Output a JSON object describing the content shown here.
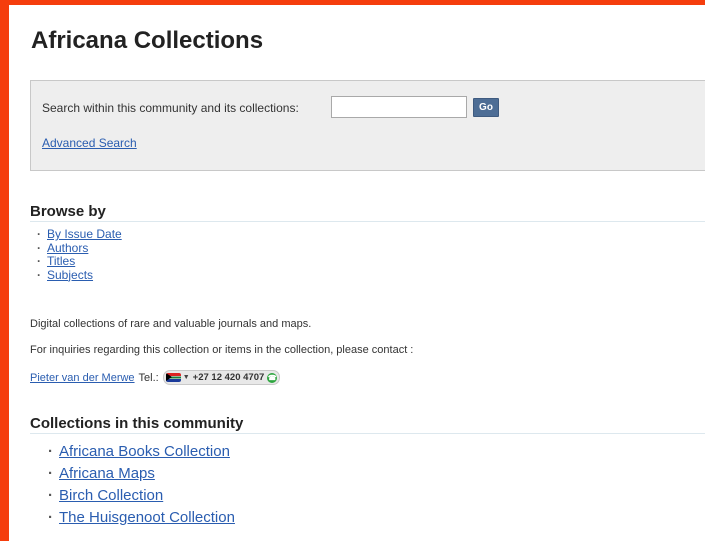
{
  "page": {
    "title": "Africana Collections"
  },
  "search": {
    "label": "Search within this community and its collections:",
    "input_value": "",
    "go_label": "Go",
    "advanced_label": "Advanced Search"
  },
  "browse": {
    "header": "Browse by",
    "items": [
      {
        "label": "By Issue Date"
      },
      {
        "label": "Authors"
      },
      {
        "label": "Titles"
      },
      {
        "label": "Subjects"
      }
    ]
  },
  "description": {
    "line1": "Digital collections of rare and valuable journals and maps.",
    "line2": "For inquiries regarding this collection or items in the collection, please contact :"
  },
  "contact": {
    "name": "Pieter van der Merwe",
    "tel_label": "Tel.:",
    "phone": "+27 12 420 4707",
    "flag_icon": "south-africa-flag-icon",
    "call_icon": "phone-call-icon"
  },
  "collections": {
    "header": "Collections in this community",
    "items": [
      {
        "label": "Africana Books Collection"
      },
      {
        "label": "Africana Maps"
      },
      {
        "label": "Birch Collection"
      },
      {
        "label": "The Huisgenoot Collection"
      }
    ]
  },
  "colors": {
    "frame": "#f53d0d",
    "link": "#2a5db0",
    "go_button": "#4d6d95",
    "search_panel": "#eeeeee"
  }
}
